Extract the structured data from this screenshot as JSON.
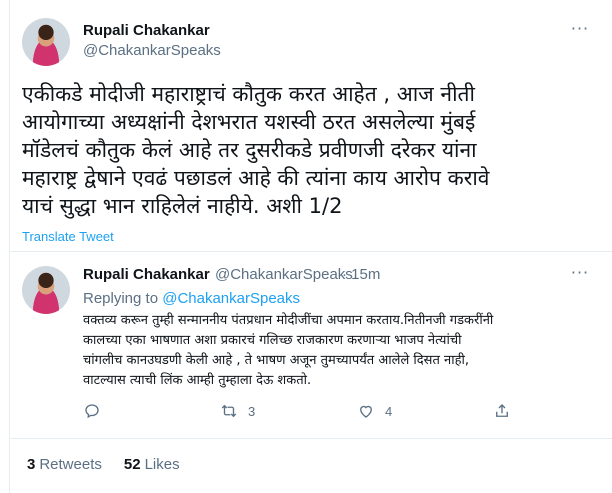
{
  "main_tweet": {
    "author_name": "Rupali Chakankar",
    "author_handle": "@ChakankarSpeaks",
    "text_lines": [
      "एकीकडे मोदीजी महाराष्ट्राचं कौतुक करत आहेत , आज नीती",
      "आयोगाच्या अध्यक्षांनी देशभरात यशस्वी ठरत असलेल्या मुंबई",
      "मॉडेलचं कौतुक केलं आहे तर दुसरीकडे प्रवीणजी दरेकर यांना",
      "महाराष्ट्र द्वेषाने एवढं पछाडलं आहे की त्यांना काय आरोप करावे",
      "याचं सुद्धा भान राहिलेलं नाहीये. अशी 1/2"
    ],
    "translate_label": "Translate Tweet"
  },
  "reply_tweet": {
    "author_name": "Rupali Chakankar",
    "author_handle": "@ChakankarSpeaks",
    "time": "· 15m",
    "replying_prefix": "Replying to",
    "replying_handle": "@ChakankarSpeaks",
    "text_lines": [
      "वक्तव्य करून तुम्ही सन्माननीय पंतप्रधान मोदीजींचा अपमान करताय.नितीनजी गडकरींनी",
      "कालच्या एका भाषणात अशा प्रकारचं गलिच्छ राजकारण करणाऱ्या भाजप नेत्यांची",
      "चांगलीच कानउघडणी केली आहे , ते भाषण अजून तुमच्यापर्यंत आलेले दिसत नाही,",
      "वाटल्यास त्याची लिंक आम्ही  तुम्हाला देऊ शकतो."
    ],
    "actions": {
      "reply_icon": "reply-icon",
      "retweet_count": "3",
      "like_count": "4",
      "share_icon": "share-icon"
    }
  },
  "stats": {
    "retweets_count": "3",
    "retweets_label": "Retweets",
    "likes_count": "52",
    "likes_label": "Likes"
  },
  "colors": {
    "accent": "#1da1f2",
    "secondary_text": "#5b7083",
    "border": "#e6ecf0"
  }
}
